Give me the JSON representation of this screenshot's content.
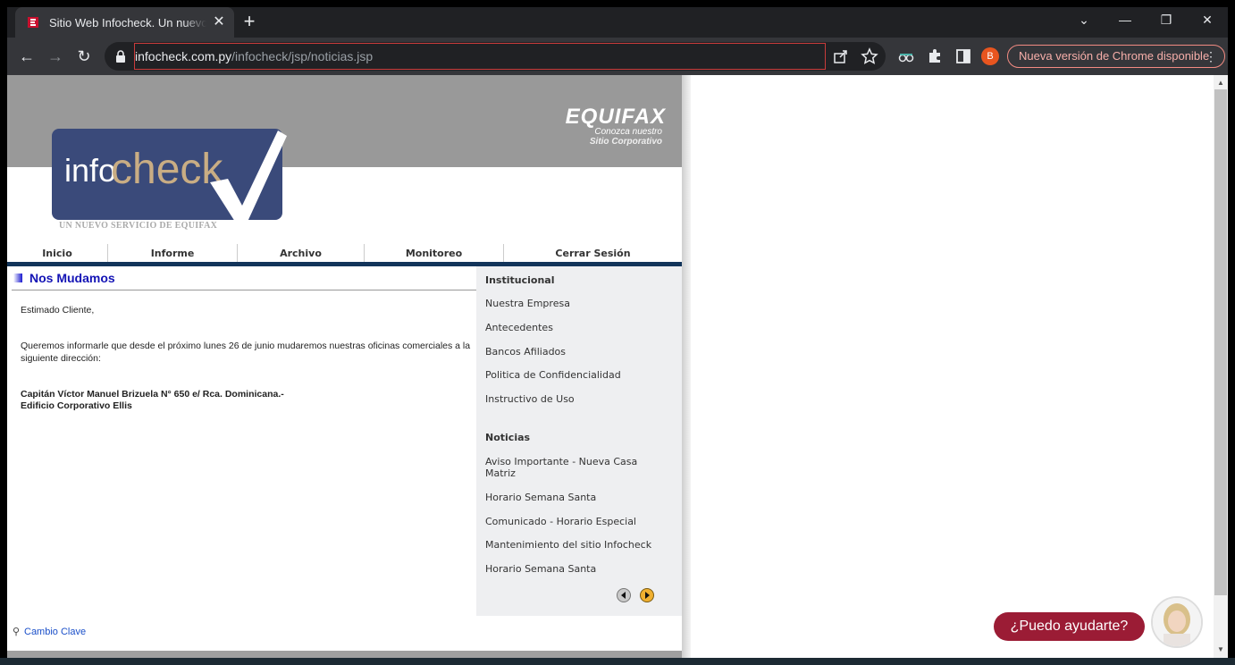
{
  "browser": {
    "tab_title": "Sitio Web Infocheck. Un nuevo de",
    "url_host": "infocheck.com.py",
    "url_path": "/infocheck/jsp/noticias.jsp",
    "profile_initial": "B",
    "update_label": "Nueva versión de Chrome disponible"
  },
  "header": {
    "brand": "EQUIFAX",
    "tagline_1": "Conozca nuestro",
    "tagline_2": "Sitio Corporativo",
    "logo_info": "info",
    "logo_check": "check",
    "logo_tagline": "UN NUEVO SERVICIO DE EQUIFAX"
  },
  "menu": {
    "items": [
      "Inicio",
      "Informe",
      "Archivo",
      "Monitoreo",
      "Cerrar Sesión"
    ]
  },
  "article": {
    "title": "Nos Mudamos",
    "greeting": "Estimado Cliente,",
    "paragraph": "Queremos informarle que desde el próximo lunes 26 de junio mudaremos nuestras oficinas comerciales a la siguiente dirección:",
    "address_line1": "Capitán Víctor Manuel Brizuela N° 650 e/ Rca. Dominicana.-",
    "address_line2": "Edificio Corporativo Ellis"
  },
  "sidebar": {
    "institucional_title": "Institucional",
    "institucional": [
      "Nuestra Empresa",
      "Antecedentes",
      "Bancos Afiliados",
      "Politica de Confidencialidad",
      "Instructivo de Uso"
    ],
    "noticias_title": "Noticias",
    "noticias": [
      "Aviso Importante - Nueva Casa Matriz",
      "Horario Semana Santa",
      "Comunicado - Horario Especial",
      "Mantenimiento del sitio Infocheck",
      "Horario Semana Santa"
    ]
  },
  "footer": {
    "cambio_clave": "Cambio Clave"
  },
  "chat": {
    "label": "¿Puedo ayudarte?"
  },
  "colors": {
    "nav_bar": "#12345a",
    "news_title": "#1313b5",
    "chat_pill": "#9b1c35",
    "logo_bg": "#3a4a7a"
  }
}
